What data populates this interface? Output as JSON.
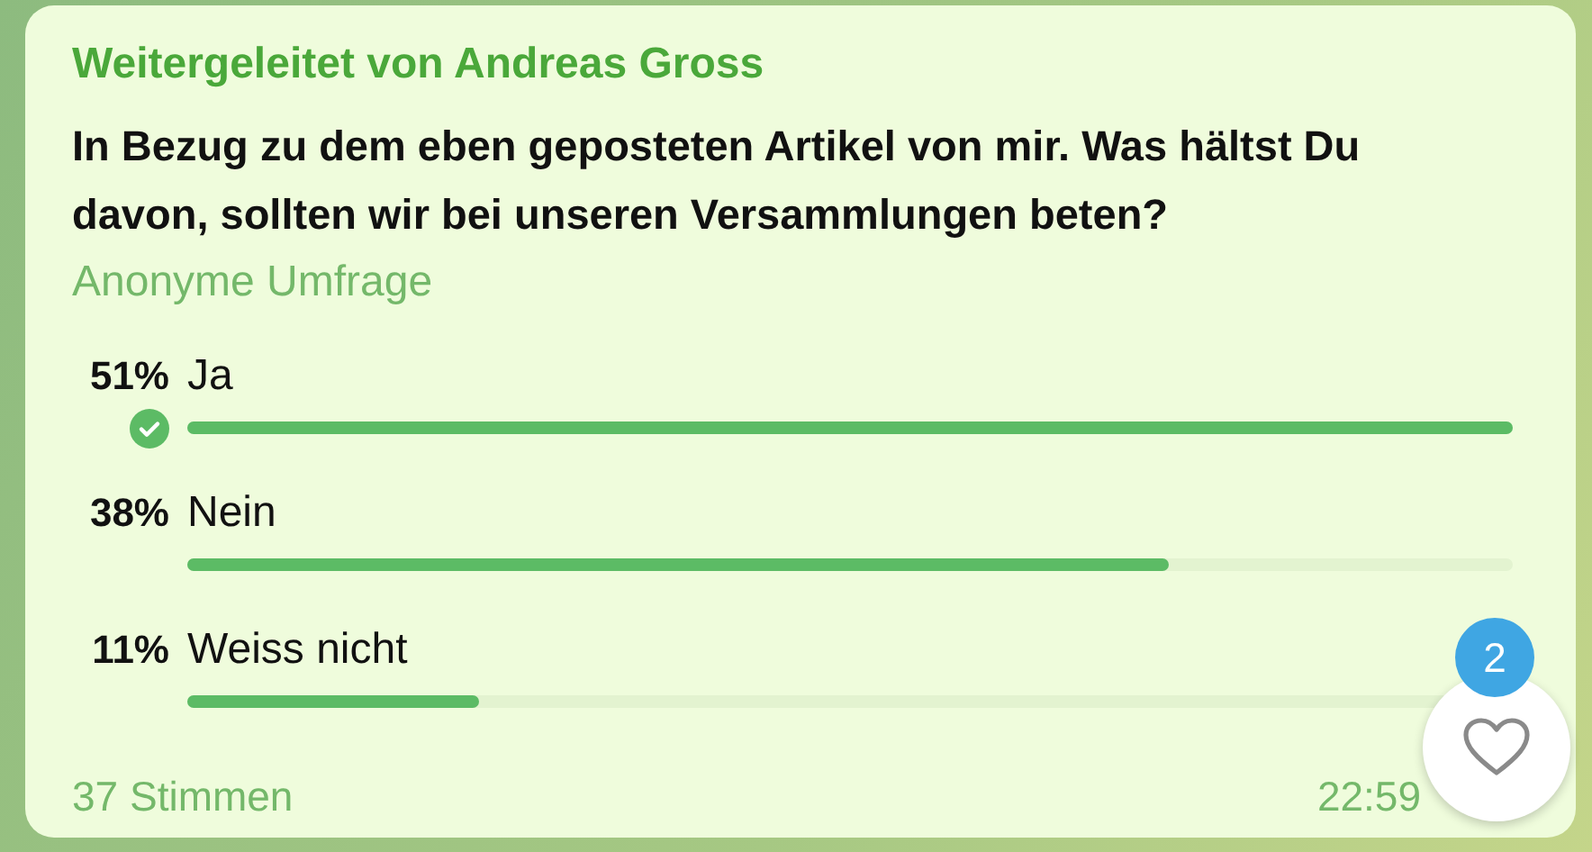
{
  "message": {
    "forwarded_from": "Weitergeleitet von Andreas Gross",
    "question": "In Bezug zu dem eben geposteten Artikel von mir. Was hältst Du davon, sollten wir bei unseren Versammlungen beten?",
    "poll_type": "Anonyme Umfrage",
    "options": [
      {
        "percent": "51%",
        "label": "Ja",
        "level": 1,
        "selected": true
      },
      {
        "percent": "38%",
        "label": "Nein",
        "level": 0.74,
        "selected": false
      },
      {
        "percent": "11%",
        "label": "Weiss nicht",
        "level": 0.22,
        "selected": false
      }
    ],
    "votes": "37 Stimmen",
    "time": "22:59"
  },
  "reaction_button": {
    "count": "2"
  }
}
